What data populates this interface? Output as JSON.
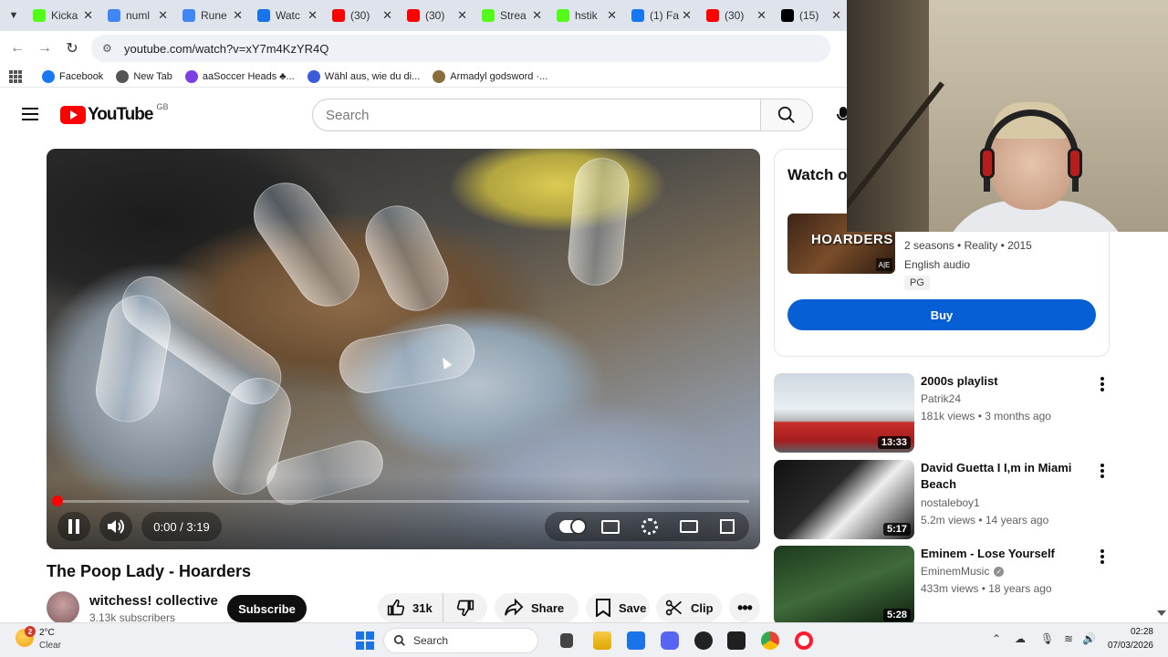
{
  "browser": {
    "tabs": [
      {
        "title": "Kicka",
        "icon": "kick-icon",
        "color": "#53fc18"
      },
      {
        "title": "numl",
        "icon": "google-icon",
        "color": "#4285f4"
      },
      {
        "title": "Rune",
        "icon": "google-translate-icon",
        "color": "#4285f4"
      },
      {
        "title": "Watc",
        "icon": "watch-icon",
        "color": "#1a73e8"
      },
      {
        "title": "(30)",
        "icon": "youtube-icon",
        "color": "#ff0000"
      },
      {
        "title": "(30)",
        "icon": "youtube-icon",
        "color": "#ff0000"
      },
      {
        "title": "Strea",
        "icon": "kick-icon",
        "color": "#53fc18"
      },
      {
        "title": "hstik",
        "icon": "kick-icon",
        "color": "#53fc18"
      },
      {
        "title": "(1) Fa",
        "icon": "facebook-icon",
        "color": "#1877f2"
      },
      {
        "title": "(30)",
        "icon": "youtube-icon",
        "color": "#ff0000"
      },
      {
        "title": "(15)",
        "icon": "x-icon",
        "color": "#000000"
      }
    ],
    "url": "youtube.com/watch?v=xY7m4KzYR4Q",
    "bookmarks": [
      {
        "label": "Facebook",
        "icon": "facebook-icon",
        "color": "#1877f2"
      },
      {
        "label": "New Tab",
        "icon": "globe-icon",
        "color": "#555555"
      },
      {
        "label": "aaSoccer Heads ♣...",
        "icon": "app-icon",
        "color": "#7b3fe4"
      },
      {
        "label": "Wähl aus, wie du di...",
        "icon": "bookmark-icon",
        "color": "#3b5bdb"
      },
      {
        "label": "Armadyl godsword ·...",
        "icon": "runescape-icon",
        "color": "#8a6d3b"
      }
    ]
  },
  "youtube": {
    "logo_text": "YouTube",
    "region": "GB",
    "search_placeholder": "Search",
    "player": {
      "progress": 0.0,
      "time": "0:00 / 3:19"
    },
    "video_title": "The Poop Lady - Hoarders",
    "channel": {
      "name": "witchess! collective",
      "subscribers": "3.13k subscribers",
      "subscribe_label": "Subscribe"
    },
    "actions": {
      "likes": "31k",
      "share": "Share",
      "save": "Save",
      "clip": "Clip"
    },
    "watch_card": {
      "title": "Watch o",
      "thumb_text": "HOARDERS",
      "seasons": "2 seasons • Reality • 2015",
      "audio": "English audio",
      "rating": "PG",
      "buy_label": "Buy"
    },
    "recommendations": [
      {
        "title": "2000s playlist",
        "channel": "Patrik24",
        "verified": false,
        "meta": "181k views • 3 months ago",
        "duration": "13:33"
      },
      {
        "title": "David Guetta I I,m in Miami Beach",
        "channel": "nostaleboy1",
        "verified": false,
        "meta": "5.2m views • 14 years ago",
        "duration": "5:17"
      },
      {
        "title": "Eminem - Lose Yourself",
        "channel": "EminemMusic",
        "verified": true,
        "meta": "433m views • 18 years ago",
        "duration": "5:28"
      }
    ]
  },
  "taskbar": {
    "weather_temp": "2°C",
    "weather_cond": "Clear",
    "weather_badge": "2",
    "search_label": "Search",
    "time": "02:28",
    "date": "07/03/2026"
  }
}
